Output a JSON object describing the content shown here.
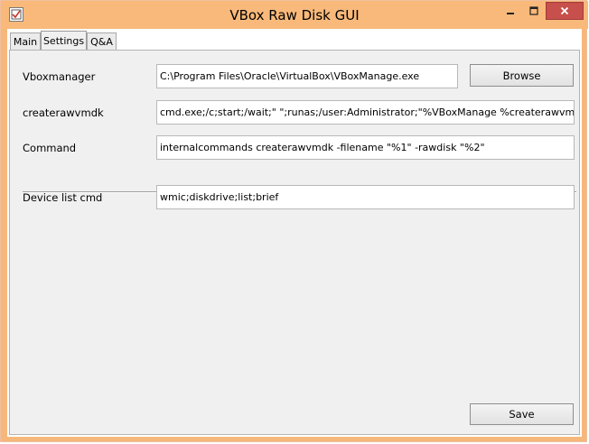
{
  "window": {
    "title": "VBox Raw Disk GUI",
    "min_icon": "minimize-icon",
    "max_icon": "maximize-icon",
    "close_icon": "close-icon",
    "accent_color": "#f8b97a",
    "close_color": "#c7504c"
  },
  "tabs": [
    {
      "label": "Main",
      "active": false
    },
    {
      "label": "Settings",
      "active": true
    },
    {
      "label": "Q&A",
      "active": false
    }
  ],
  "settings": {
    "vboxmanager": {
      "label": "Vboxmanager",
      "value": "C:\\Program Files\\Oracle\\VirtualBox\\VBoxManage.exe"
    },
    "browse_label": "Browse",
    "createrawvmdk": {
      "label": "createrawvmdk",
      "value": "cmd.exe;/c;start;/wait;\" \";runas;/user:Administrator;\"%VBoxManage %createrawvmdk\""
    },
    "command": {
      "label": "Command",
      "value": "internalcommands createrawvmdk -filename \"%1\" -rawdisk \"%2\""
    },
    "device_list_cmd": {
      "label": "Device list cmd",
      "value": "wmic;diskdrive;list;brief"
    },
    "save_label": "Save"
  }
}
